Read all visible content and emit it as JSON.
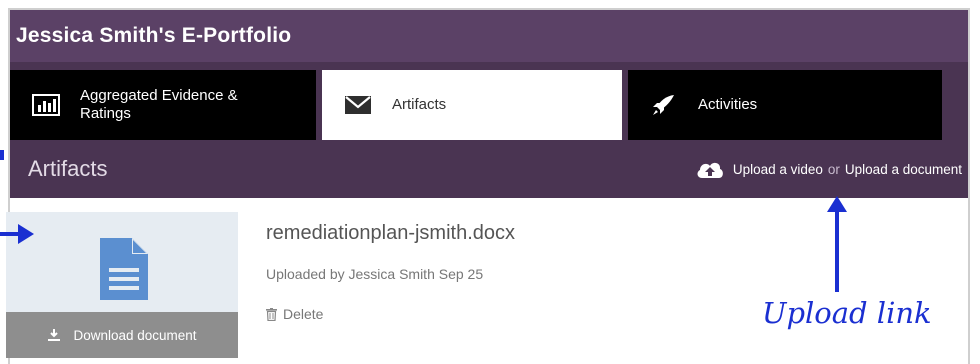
{
  "header": {
    "title": "Jessica Smith's E-Portfolio"
  },
  "tabs": [
    {
      "label": "Aggregated Evidence & Ratings",
      "icon": "bar-chart-icon",
      "active": false
    },
    {
      "label": "Artifacts",
      "icon": "envelope-icon",
      "active": true
    },
    {
      "label": "Activities",
      "icon": "rocket-icon",
      "active": false
    }
  ],
  "section": {
    "title": "Artifacts",
    "upload_video_label": "Upload a video",
    "or_label": "or",
    "upload_document_label": "Upload a document"
  },
  "artifact": {
    "file_name": "remediationplan-jsmith.docx",
    "uploaded_by": "Uploaded by Jessica Smith Sep 25",
    "download_label": "Download document",
    "delete_label": "Delete"
  },
  "annotation": {
    "text": "Upload link"
  },
  "colors": {
    "header_bg": "#5b4166",
    "tabbar_bg": "#4a3452",
    "annotation_blue": "#1a2fd1",
    "doc_icon_blue": "#5b8fd0"
  }
}
